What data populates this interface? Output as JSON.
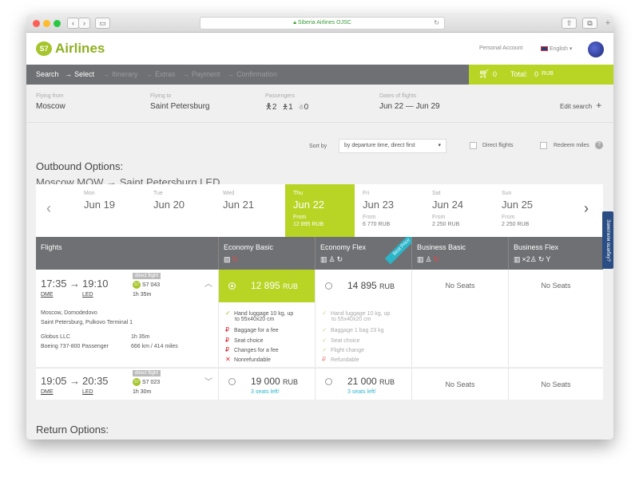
{
  "browser": {
    "url": "Siberia Airlines OJSC"
  },
  "header": {
    "logo_mark": "S7",
    "logo_text": "Airlines",
    "account": "Personal Account",
    "language": "English"
  },
  "nav": {
    "steps": [
      "Search",
      "Select",
      "Itinerary",
      "Extras",
      "Payment",
      "Confirmation"
    ],
    "arrow": "→",
    "cart_count": "0",
    "total_label": "Total:",
    "total_value": "0",
    "total_currency": "RUB"
  },
  "search": {
    "from_label": "Flying from",
    "from": "Moscow",
    "to_label": "Flying to",
    "to": "Saint Petersburg",
    "pax_label": "Passengers",
    "adults": "2",
    "children": "1",
    "infants": "0",
    "dates_label": "Dates of flights",
    "dates": "Jun 22 — Jun 29",
    "edit": "Edit search"
  },
  "sort": {
    "label": "Sort by",
    "value": "by departure time, direct first",
    "direct": "Direct flights",
    "redeem": "Redeem miles"
  },
  "outbound": {
    "heading": "Outbound Options:",
    "route": "Moscow MOW → Saint Petersburg LED"
  },
  "days": [
    {
      "dow": "Mon",
      "date": "Jun 19",
      "from": "",
      "price": ""
    },
    {
      "dow": "Tue",
      "date": "Jun 20",
      "from": "",
      "price": ""
    },
    {
      "dow": "Wed",
      "date": "Jun 21",
      "from": "",
      "price": ""
    },
    {
      "dow": "Thu",
      "date": "Jun 22",
      "from": "From",
      "price": "12 895 RUB"
    },
    {
      "dow": "Fri",
      "date": "Jun 23",
      "from": "From",
      "price": "6 770 RUB"
    },
    {
      "dow": "Sat",
      "date": "Jun 24",
      "from": "From",
      "price": "2 250 RUB"
    },
    {
      "dow": "Sun",
      "date": "Jun 25",
      "from": "From",
      "price": "2 250 RUB"
    }
  ],
  "table": {
    "headers": [
      "Flights",
      "Economy Basic",
      "Economy Flex",
      "Business Basic",
      "Business Flex"
    ],
    "ribbon": "Best Price",
    "flex_pax": "×2"
  },
  "flight1": {
    "dep": "17:35",
    "arr": "19:10",
    "dep_code": "DME",
    "arr_code": "LED",
    "badge": "direct flight",
    "flight_no": "S7 043",
    "duration": "1h 35m",
    "from_airport": "Moscow, Domodedovo",
    "to_airport": "Saint Petersburg, Pulkovo Terminal 1",
    "operator": "Globus LLC",
    "op_duration": "1h 35m",
    "aircraft": "Boeing 737-800 Passenger",
    "distance": "666 km / 414 miles",
    "eco_basic_price": "12 895",
    "eco_flex_price": "14 895",
    "currency": "RUB",
    "no_seats": "No Seats",
    "basic_features": [
      "Hand luggage 10 kg, up",
      "to 55x40x20 cm",
      "Baggage for a fee",
      "Seat choice",
      "Changes for a fee",
      "Nonrefundable"
    ],
    "flex_features": [
      "Hand luggage 10 kg, up",
      "to 55x40x20 cm",
      "Baggage 1 bag 23 kg",
      "Seat choice",
      "Flight change",
      "Refundable"
    ]
  },
  "flight2": {
    "dep": "19:05",
    "arr": "20:35",
    "dep_code": "DME",
    "arr_code": "LED",
    "badge": "direct flight",
    "flight_no": "S7 023",
    "duration": "1h 30m",
    "eco_basic_price": "19 000",
    "eco_flex_price": "21 000",
    "currency": "RUB",
    "seats_left": "3 seats left!",
    "no_seats": "No Seats"
  },
  "return": {
    "heading": "Return Options:"
  },
  "feedback": "Заметили ошибку?"
}
